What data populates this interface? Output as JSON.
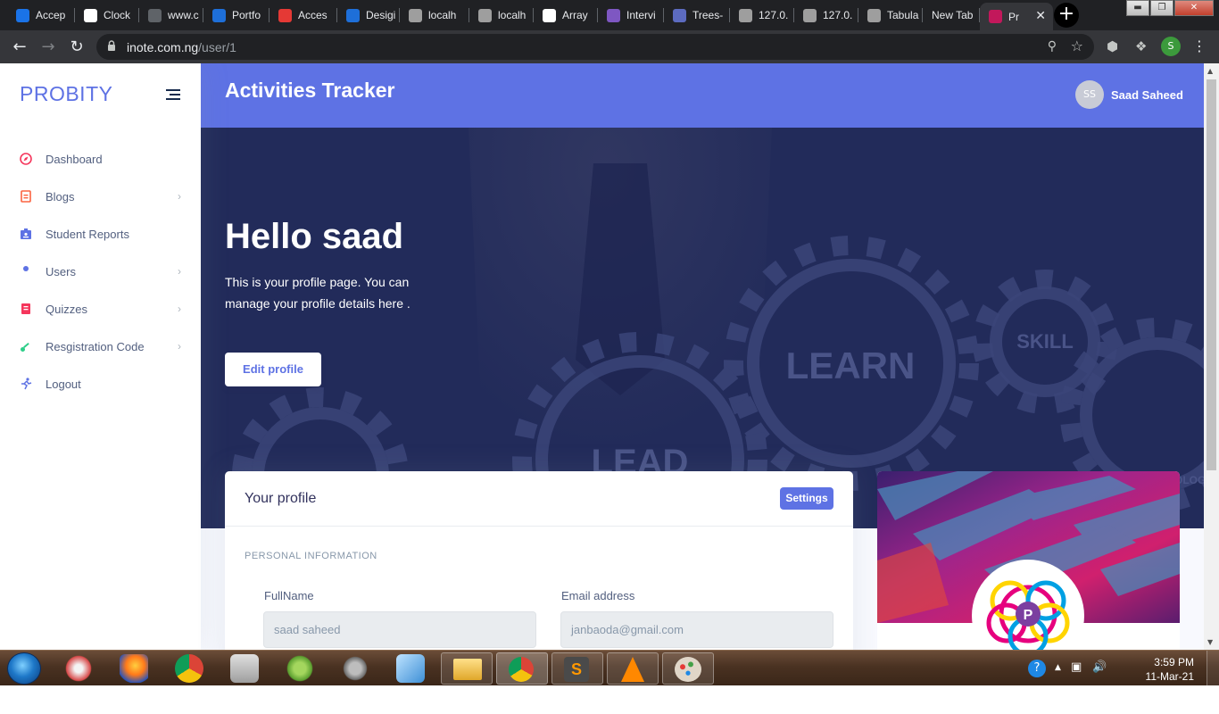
{
  "browser": {
    "tabs": [
      {
        "label": "Accep",
        "color": "#1a73e8"
      },
      {
        "label": "Clock",
        "color": "#ffffff"
      },
      {
        "label": "www.c",
        "color": "#5f6368"
      },
      {
        "label": "Portfo",
        "color": "#1e6fd9"
      },
      {
        "label": "Acces",
        "color": "#e53935"
      },
      {
        "label": "Desigi",
        "color": "#1e6fd9"
      },
      {
        "label": "localh",
        "color": "#9e9e9e"
      },
      {
        "label": "localh",
        "color": "#9e9e9e"
      },
      {
        "label": "Array",
        "color": "#ffffff"
      },
      {
        "label": "Intervi",
        "color": "#7e57c2"
      },
      {
        "label": "Trees-",
        "color": "#5c6bc0"
      },
      {
        "label": "127.0.",
        "color": "#9e9e9e"
      },
      {
        "label": "127.0.",
        "color": "#9e9e9e"
      },
      {
        "label": "Tabula",
        "color": "#9e9e9e"
      },
      {
        "label": "New Tab",
        "color": ""
      },
      {
        "label": "Pr",
        "color": "#c2185b"
      }
    ],
    "new_tab_symbol": "+",
    "url_host": "inote.com.ng",
    "url_path": "/user/1",
    "profile_initial": "S"
  },
  "sidebar": {
    "brand": "PROBITY",
    "items": [
      {
        "label": "Dashboard",
        "icon": "compass-icon",
        "color": "#f5365c",
        "expandable": false
      },
      {
        "label": "Blogs",
        "icon": "file-icon",
        "color": "#fb6340",
        "expandable": true
      },
      {
        "label": "Student Reports",
        "icon": "id-card-icon",
        "color": "#5e72e4",
        "expandable": false
      },
      {
        "label": "Users",
        "icon": "user-icon",
        "color": "#5e72e4",
        "expandable": true
      },
      {
        "label": "Quizzes",
        "icon": "book-icon",
        "color": "#f5365c",
        "expandable": true
      },
      {
        "label": "Resgistration Code",
        "icon": "key-icon",
        "color": "#2dce89",
        "expandable": true
      },
      {
        "label": "Logout",
        "icon": "runner-icon",
        "color": "#5e72e4",
        "expandable": false
      }
    ]
  },
  "header": {
    "title": "Activities Tracker",
    "user_initials": "SS",
    "user_name": "Saad Saheed"
  },
  "hero": {
    "greeting": "Hello saad",
    "description": "This is your profile page. You can manage your profile details here .",
    "edit_button": "Edit profile",
    "background_words": [
      "LEARN",
      "SKILL",
      "LEAD",
      "TECHNOLOGY"
    ]
  },
  "profile_card": {
    "title": "Your profile",
    "settings_button": "Settings",
    "section_label": "PERSONAL INFORMATION",
    "fullname_label": "FullName",
    "fullname_value": "saad saheed",
    "email_label": "Email address",
    "email_value": "janbaoda@gmail.com"
  },
  "side_card": {
    "logo_letter": "P"
  },
  "taskbar": {
    "time": "3:59 PM",
    "date": "11-Mar-21"
  },
  "colors": {
    "primary": "#5e72e4",
    "hero_bg": "#222b5a",
    "sidebar_text": "#525f7f"
  }
}
